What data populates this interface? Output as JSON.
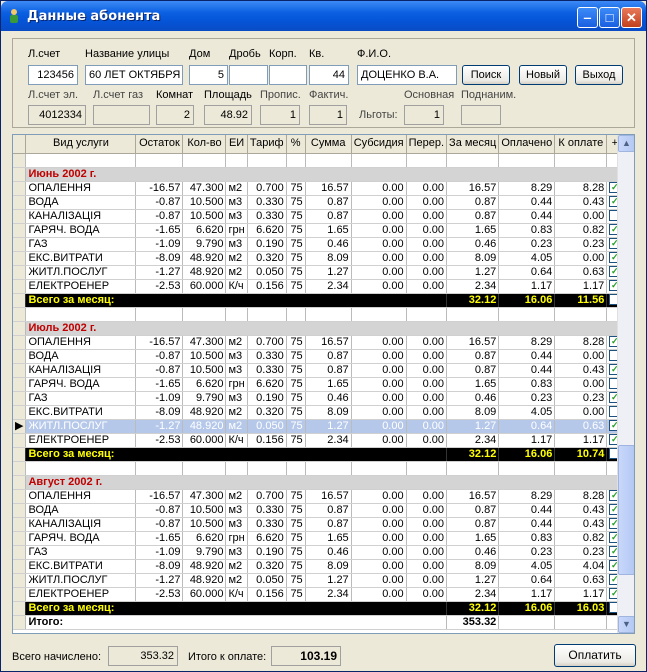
{
  "window": {
    "title": "Данные абонента"
  },
  "form": {
    "labels": {
      "account": "Л.счет",
      "street": "Название улицы",
      "house": "Дом",
      "fraction": "Дробь",
      "building": "Корп.",
      "apt": "Кв.",
      "fio": "Ф.И.О.",
      "acc_el": "Л.счет эл.",
      "acc_gas": "Л.счет газ",
      "rooms": "Комнат",
      "area": "Площадь",
      "registered": "Пропис.",
      "actual": "Фактич.",
      "benefits": "Льготы:",
      "main": "Основная",
      "tenant": "Поднаним."
    },
    "values": {
      "account": "123456",
      "street": "60 ЛЕТ ОКТЯБРЯ",
      "house": "5",
      "fraction": "",
      "building": "",
      "apt": "44",
      "fio": "ДОЦЕНКО В.А.",
      "acc_el": "4012334",
      "acc_gas": "",
      "rooms": "2",
      "area": "48.92",
      "registered": "1",
      "actual": "1",
      "main": "1",
      "tenant": ""
    },
    "buttons": {
      "search": "Поиск",
      "new": "Новый",
      "exit": "Выход"
    }
  },
  "grid": {
    "columns": [
      "Вид услуги",
      "Остаток",
      "Кол-во",
      "ЕИ",
      "Тариф",
      "%",
      "Сумма",
      "Субсидия",
      "Перер.",
      "За месяц",
      "Оплачено",
      "К оплате",
      "+"
    ],
    "months": [
      {
        "name": "Июнь 2002 г.",
        "rows": [
          [
            "ОПАЛЕННЯ",
            "-16.57",
            "47.300",
            "м2",
            "0.700",
            "75",
            "16.57",
            "0.00",
            "0.00",
            "16.57",
            "8.29",
            "8.28",
            true
          ],
          [
            "ВОДА",
            "-0.87",
            "10.500",
            "м3",
            "0.330",
            "75",
            "0.87",
            "0.00",
            "0.00",
            "0.87",
            "0.44",
            "0.43",
            true
          ],
          [
            "КАНАЛІЗАЦІЯ",
            "-0.87",
            "10.500",
            "м3",
            "0.330",
            "75",
            "0.87",
            "0.00",
            "0.00",
            "0.87",
            "0.44",
            "0.00",
            false
          ],
          [
            "ГАРЯЧ. ВОДА",
            "-1.65",
            "6.620",
            "грн",
            "6.620",
            "75",
            "1.65",
            "0.00",
            "0.00",
            "1.65",
            "0.83",
            "0.82",
            true
          ],
          [
            "ГАЗ",
            "-1.09",
            "9.790",
            "м3",
            "0.190",
            "75",
            "0.46",
            "0.00",
            "0.00",
            "0.46",
            "0.23",
            "0.23",
            true
          ],
          [
            "ЕКС.ВИТРАТИ",
            "-8.09",
            "48.920",
            "м2",
            "0.320",
            "75",
            "8.09",
            "0.00",
            "0.00",
            "8.09",
            "4.05",
            "0.00",
            true
          ],
          [
            "ЖИТЛ.ПОСЛУГ",
            "-1.27",
            "48.920",
            "м2",
            "0.050",
            "75",
            "1.27",
            "0.00",
            "0.00",
            "1.27",
            "0.64",
            "0.63",
            true
          ],
          [
            "ЕЛЕКТРОЕНЕР",
            "-2.53",
            "60.000",
            "К/ч",
            "0.156",
            "75",
            "2.34",
            "0.00",
            "0.00",
            "2.34",
            "1.17",
            "1.17",
            true
          ]
        ],
        "total": {
          "label": "Всего за месяц:",
          "month": "32.12",
          "paid": "16.06",
          "due": "11.56"
        }
      },
      {
        "name": "Июль 2002 г.",
        "rows": [
          [
            "ОПАЛЕННЯ",
            "-16.57",
            "47.300",
            "м2",
            "0.700",
            "75",
            "16.57",
            "0.00",
            "0.00",
            "16.57",
            "8.29",
            "8.28",
            true
          ],
          [
            "ВОДА",
            "-0.87",
            "10.500",
            "м3",
            "0.330",
            "75",
            "0.87",
            "0.00",
            "0.00",
            "0.87",
            "0.44",
            "0.00",
            false
          ],
          [
            "КАНАЛІЗАЦІЯ",
            "-0.87",
            "10.500",
            "м3",
            "0.330",
            "75",
            "0.87",
            "0.00",
            "0.00",
            "0.87",
            "0.44",
            "0.43",
            true
          ],
          [
            "ГАРЯЧ. ВОДА",
            "-1.65",
            "6.620",
            "грн",
            "6.620",
            "75",
            "1.65",
            "0.00",
            "0.00",
            "1.65",
            "0.83",
            "0.00",
            false
          ],
          [
            "ГАЗ",
            "-1.09",
            "9.790",
            "м3",
            "0.190",
            "75",
            "0.46",
            "0.00",
            "0.00",
            "0.46",
            "0.23",
            "0.23",
            true
          ],
          [
            "ЕКС.ВИТРАТИ",
            "-8.09",
            "48.920",
            "м2",
            "0.320",
            "75",
            "8.09",
            "0.00",
            "0.00",
            "8.09",
            "4.05",
            "0.00",
            false
          ],
          [
            "ЖИТЛ.ПОСЛУГ",
            "-1.27",
            "48.920",
            "м2",
            "0.050",
            "75",
            "1.27",
            "0.00",
            "0.00",
            "1.27",
            "0.64",
            "0.63",
            true,
            "sel"
          ],
          [
            "ЕЛЕКТРОЕНЕР",
            "-2.53",
            "60.000",
            "К/ч",
            "0.156",
            "75",
            "2.34",
            "0.00",
            "0.00",
            "2.34",
            "1.17",
            "1.17",
            true
          ]
        ],
        "total": {
          "label": "Всего за месяц:",
          "month": "32.12",
          "paid": "16.06",
          "due": "10.74"
        }
      },
      {
        "name": "Август 2002 г.",
        "rows": [
          [
            "ОПАЛЕННЯ",
            "-16.57",
            "47.300",
            "м2",
            "0.700",
            "75",
            "16.57",
            "0.00",
            "0.00",
            "16.57",
            "8.29",
            "8.28",
            true
          ],
          [
            "ВОДА",
            "-0.87",
            "10.500",
            "м3",
            "0.330",
            "75",
            "0.87",
            "0.00",
            "0.00",
            "0.87",
            "0.44",
            "0.43",
            true
          ],
          [
            "КАНАЛІЗАЦІЯ",
            "-0.87",
            "10.500",
            "м3",
            "0.330",
            "75",
            "0.87",
            "0.00",
            "0.00",
            "0.87",
            "0.44",
            "0.43",
            true
          ],
          [
            "ГАРЯЧ. ВОДА",
            "-1.65",
            "6.620",
            "грн",
            "6.620",
            "75",
            "1.65",
            "0.00",
            "0.00",
            "1.65",
            "0.83",
            "0.82",
            true
          ],
          [
            "ГАЗ",
            "-1.09",
            "9.790",
            "м3",
            "0.190",
            "75",
            "0.46",
            "0.00",
            "0.00",
            "0.46",
            "0.23",
            "0.23",
            true
          ],
          [
            "ЕКС.ВИТРАТИ",
            "-8.09",
            "48.920",
            "м2",
            "0.320",
            "75",
            "8.09",
            "0.00",
            "0.00",
            "8.09",
            "4.05",
            "4.04",
            true
          ],
          [
            "ЖИТЛ.ПОСЛУГ",
            "-1.27",
            "48.920",
            "м2",
            "0.050",
            "75",
            "1.27",
            "0.00",
            "0.00",
            "1.27",
            "0.64",
            "0.63",
            true
          ],
          [
            "ЕЛЕКТРОЕНЕР",
            "-2.53",
            "60.000",
            "К/ч",
            "0.156",
            "75",
            "2.34",
            "0.00",
            "0.00",
            "2.34",
            "1.17",
            "1.17",
            true
          ]
        ],
        "total": {
          "label": "Всего за месяц:",
          "month": "32.12",
          "paid": "16.06",
          "due": "16.03"
        }
      }
    ],
    "itogo": {
      "label": "Итого:",
      "value": "353.32"
    }
  },
  "footer": {
    "charged_label": "Всего начислено:",
    "charged": "353.32",
    "to_pay_label": "Итого к оплате:",
    "to_pay": "103.19",
    "pay_button": "Оплатить"
  },
  "colors": {
    "month_header": "#c00000",
    "total_text": "#ffff00",
    "total_bg": "#000000",
    "title_bar": "#0553d6"
  }
}
